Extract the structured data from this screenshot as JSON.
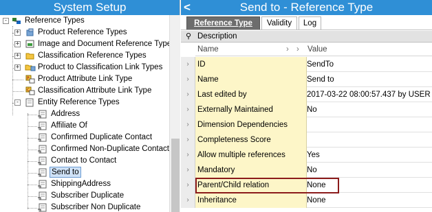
{
  "left_panel": {
    "title": "System Setup",
    "tree": [
      {
        "label": "Reference Types",
        "icon": "reference-types-icon",
        "expander": "-"
      },
      {
        "label": "Product Reference Types",
        "icon": "product-icon",
        "expander": "+"
      },
      {
        "label": "Image and Document Reference Types",
        "icon": "image-document-icon",
        "expander": "+"
      },
      {
        "label": "Classification Reference Types",
        "icon": "classification-icon",
        "expander": "+"
      },
      {
        "label": "Product to Classification Link Types",
        "icon": "link-icon",
        "expander": "+"
      },
      {
        "label": "Product Attribute Link Type",
        "icon": "attribute-link-icon",
        "expander": ""
      },
      {
        "label": "Classification Attribute Link Type",
        "icon": "attribute-link-icon",
        "expander": ""
      },
      {
        "label": "Entity Reference Types",
        "icon": "folder-icon",
        "expander": "-"
      },
      {
        "label": "Address",
        "icon": "entity-ref-icon",
        "expander": ""
      },
      {
        "label": "Affiliate Of",
        "icon": "entity-ref-icon",
        "expander": ""
      },
      {
        "label": "Confirmed Duplicate Contact",
        "icon": "entity-ref-icon",
        "expander": ""
      },
      {
        "label": "Confirmed Non-Duplicate Contact",
        "icon": "entity-ref-icon",
        "expander": ""
      },
      {
        "label": "Contact to Contact",
        "icon": "entity-ref-icon",
        "expander": ""
      },
      {
        "label": "Send to",
        "icon": "entity-ref-icon",
        "expander": "",
        "selected": true
      },
      {
        "label": "ShippingAddress",
        "icon": "entity-ref-icon",
        "expander": ""
      },
      {
        "label": "Subscriber Duplicate",
        "icon": "entity-ref-icon",
        "expander": ""
      },
      {
        "label": "Subscriber Non Duplicate",
        "icon": "entity-ref-icon",
        "expander": ""
      }
    ]
  },
  "right_panel": {
    "title": "Send to - Reference Type",
    "back_glyph": "<",
    "tabs": [
      {
        "label": "Reference Type",
        "active": true
      },
      {
        "label": "Validity",
        "active": false
      },
      {
        "label": "Log",
        "active": false
      }
    ],
    "grid": {
      "section": "Description",
      "pin_glyph": "⚲",
      "col_name": "Name",
      "col_value": "Value",
      "rows": [
        {
          "name": "ID",
          "value": "SendTo"
        },
        {
          "name": "Name",
          "value": "Send to"
        },
        {
          "name": "Last edited by",
          "value": "2017-03-22 08:00:57.437 by USER"
        },
        {
          "name": "Externally Maintained",
          "value": "No"
        },
        {
          "name": "Dimension Dependencies",
          "value": ""
        },
        {
          "name": "Completeness Score",
          "value": ""
        },
        {
          "name": "Allow multiple references",
          "value": "Yes"
        },
        {
          "name": "Mandatory",
          "value": "No"
        },
        {
          "name": "Parent/Child relation",
          "value": "None",
          "highlighted": true
        },
        {
          "name": "Inheritance",
          "value": "None"
        }
      ]
    }
  },
  "colors": {
    "title_bar": "#2f8fd6",
    "name_cell": "#fdf6c8",
    "highlight_border": "#8b1a1a",
    "active_tab": "#6d6d6d"
  }
}
